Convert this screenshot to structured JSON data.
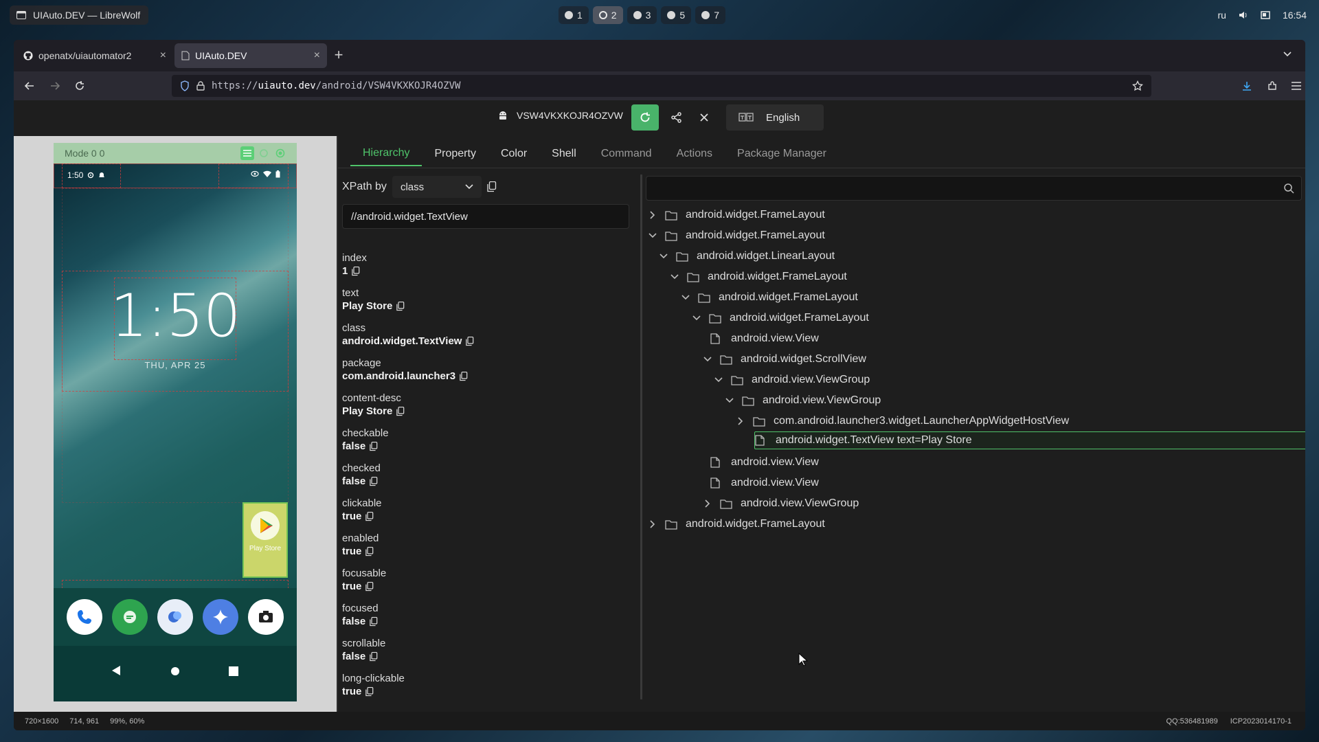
{
  "desktop": {
    "window_title": "UIAuto.DEV — LibreWolf",
    "workspaces": [
      "1",
      "2",
      "3",
      "5",
      "7"
    ],
    "active_workspace": "2",
    "tray": {
      "lang": "ru",
      "time": "16:54"
    }
  },
  "browser": {
    "tabs": [
      {
        "label": "openatx/uiautomator2",
        "active": false
      },
      {
        "label": "UIAuto.DEV",
        "active": true
      }
    ],
    "url_scheme": "https://",
    "url_host": "uiauto.dev",
    "url_path": "/android/VSW4VKXKOJR4OZVW"
  },
  "device_bar": {
    "serial": "VSW4VKXKOJR4OZVW",
    "language": "English",
    "accent_color": "#49b36a"
  },
  "phone": {
    "mode_label": "Mode 0 0",
    "status_time": "1:50",
    "clock": "1:50",
    "date": "THU, APR 25",
    "widget_label": "Play Store",
    "dock_apps": [
      "phone-icon",
      "messages-icon",
      "chat-icon",
      "assistant-icon",
      "camera-icon"
    ]
  },
  "tabs": [
    {
      "label": "Hierarchy",
      "state": "active"
    },
    {
      "label": "Property",
      "state": "normal"
    },
    {
      "label": "Color",
      "state": "normal"
    },
    {
      "label": "Shell",
      "state": "normal"
    },
    {
      "label": "Command",
      "state": "dim"
    },
    {
      "label": "Actions",
      "state": "dim"
    },
    {
      "label": "Package Manager",
      "state": "dim"
    }
  ],
  "xpath": {
    "label": "XPath by",
    "selected": "class",
    "value": "//android.widget.TextView"
  },
  "properties": [
    {
      "key": "index",
      "value": "1"
    },
    {
      "key": "text",
      "value": "Play Store"
    },
    {
      "key": "class",
      "value": "android.widget.TextView"
    },
    {
      "key": "package",
      "value": "com.android.launcher3"
    },
    {
      "key": "content-desc",
      "value": "Play Store"
    },
    {
      "key": "checkable",
      "value": "false"
    },
    {
      "key": "checked",
      "value": "false"
    },
    {
      "key": "clickable",
      "value": "true"
    },
    {
      "key": "enabled",
      "value": "true"
    },
    {
      "key": "focusable",
      "value": "true"
    },
    {
      "key": "focused",
      "value": "false"
    },
    {
      "key": "scrollable",
      "value": "false"
    },
    {
      "key": "long-clickable",
      "value": "true"
    }
  ],
  "tree": [
    {
      "label": "android.widget.FrameLayout",
      "depth": 0,
      "chevron": "right",
      "icon": "folder"
    },
    {
      "label": "android.widget.FrameLayout",
      "depth": 0,
      "chevron": "down",
      "icon": "folder"
    },
    {
      "label": "android.widget.LinearLayout",
      "depth": 1,
      "chevron": "down",
      "icon": "folder"
    },
    {
      "label": "android.widget.FrameLayout",
      "depth": 2,
      "chevron": "down",
      "icon": "folder"
    },
    {
      "label": "android.widget.FrameLayout",
      "depth": 3,
      "chevron": "down",
      "icon": "folder"
    },
    {
      "label": "android.widget.FrameLayout",
      "depth": 4,
      "chevron": "down",
      "icon": "folder"
    },
    {
      "label": "android.view.View",
      "depth": 5,
      "chevron": "none",
      "icon": "file"
    },
    {
      "label": "android.widget.ScrollView",
      "depth": 5,
      "chevron": "down",
      "icon": "folder"
    },
    {
      "label": "android.view.ViewGroup",
      "depth": 6,
      "chevron": "down",
      "icon": "folder"
    },
    {
      "label": "android.view.ViewGroup",
      "depth": 7,
      "chevron": "down",
      "icon": "folder"
    },
    {
      "label": "com.android.launcher3.widget.LauncherAppWidgetHostView",
      "depth": 8,
      "chevron": "right",
      "icon": "folder"
    },
    {
      "label": "android.widget.TextView text=Play Store",
      "depth": 9,
      "chevron": "none",
      "icon": "file",
      "selected": true
    },
    {
      "label": "android.view.View",
      "depth": 5,
      "chevron": "none",
      "icon": "file"
    },
    {
      "label": "android.view.View",
      "depth": 5,
      "chevron": "none",
      "icon": "file"
    },
    {
      "label": "android.view.ViewGroup",
      "depth": 5,
      "chevron": "right",
      "icon": "folder"
    },
    {
      "label": "android.widget.FrameLayout",
      "depth": 0,
      "chevron": "right",
      "icon": "folder"
    }
  ],
  "statusbar": {
    "resolution": "720×1600",
    "coords": "714, 961",
    "percent": "99%, 60%",
    "qq": "QQ:536481989",
    "icp": "ICP2023014170-1"
  }
}
